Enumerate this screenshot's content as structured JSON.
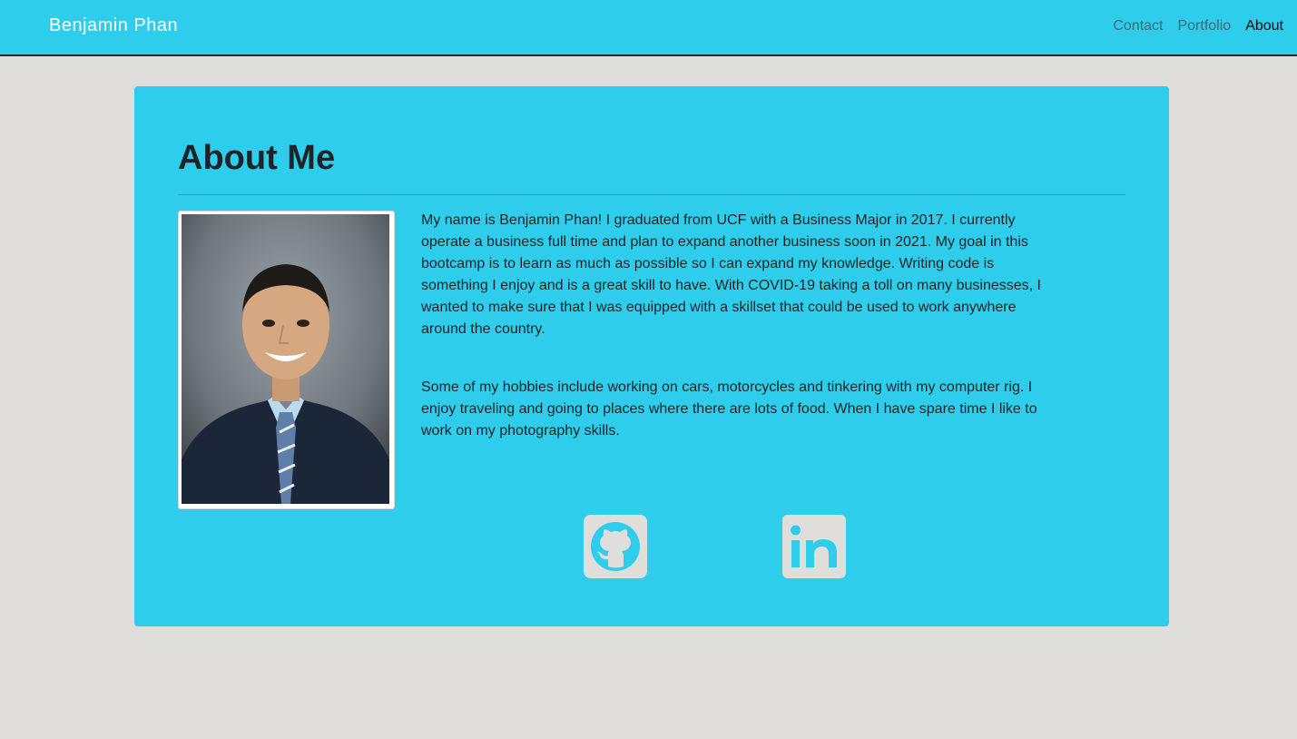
{
  "nav": {
    "brand": "Benjamin Phan",
    "links": [
      {
        "label": "Contact",
        "active": false
      },
      {
        "label": "Portfolio",
        "active": false
      },
      {
        "label": "About",
        "active": true
      }
    ]
  },
  "about": {
    "title": "About Me",
    "paragraphs": [
      "My name is Benjamin Phan! I graduated from UCF with a Business Major in 2017. I currently operate a business full time and plan to expand another business soon in 2021. My goal in this bootcamp is to learn as much as possible so I can expand my knowledge. Writing code is something I enjoy and is a great skill to have. With COVID-19 taking a toll on many businesses, I wanted to make sure that I was equipped with a skillset that could be used to work anywhere around the country.",
      "Some of my hobbies include working on cars, motorcycles and tinkering with my computer rig. I enjoy traveling and going to places where there are lots of food. When I have spare time I like to work on my photography skills."
    ]
  },
  "social": [
    {
      "icon": "github-icon"
    },
    {
      "icon": "linkedin-icon"
    }
  ],
  "colors": {
    "accent": "#2dcdeb",
    "background": "#dfdedb",
    "text": "#1d2326",
    "icon_fill": "#dfdedb"
  }
}
